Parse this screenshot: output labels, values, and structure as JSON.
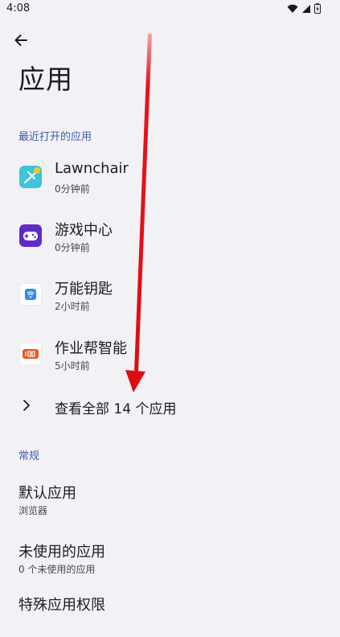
{
  "status_bar": {
    "time": "4:08",
    "icons": [
      "wifi-icon",
      "signal-icon",
      "battery-icon"
    ]
  },
  "header": {
    "back_icon": "arrow-left-icon",
    "title": "应用"
  },
  "recent": {
    "header": "最近打开的应用",
    "apps": [
      {
        "name": "Lawnchair",
        "sub": "0分钟前",
        "icon": "lawnchair-icon"
      },
      {
        "name": "游戏中心",
        "sub": "0分钟前",
        "icon": "game-center-icon"
      },
      {
        "name": "万能钥匙",
        "sub": "2小时前",
        "icon": "wifi-key-icon"
      },
      {
        "name": "作业帮智能",
        "sub": "5小时前",
        "icon": "zuoyebang-icon"
      }
    ],
    "see_all": "查看全部 14 个应用",
    "see_all_icon": "chevron-right-icon"
  },
  "general": {
    "header": "常规",
    "items": [
      {
        "title": "默认应用",
        "sub": "浏览器"
      },
      {
        "title": "未使用的应用",
        "sub": "0 个未使用的应用"
      },
      {
        "title": "特殊应用权限",
        "sub": ""
      }
    ]
  },
  "colors": {
    "background": "#f2f1f6",
    "accent": "#3f5ba9",
    "annotation_arrow": "#e8141c"
  }
}
